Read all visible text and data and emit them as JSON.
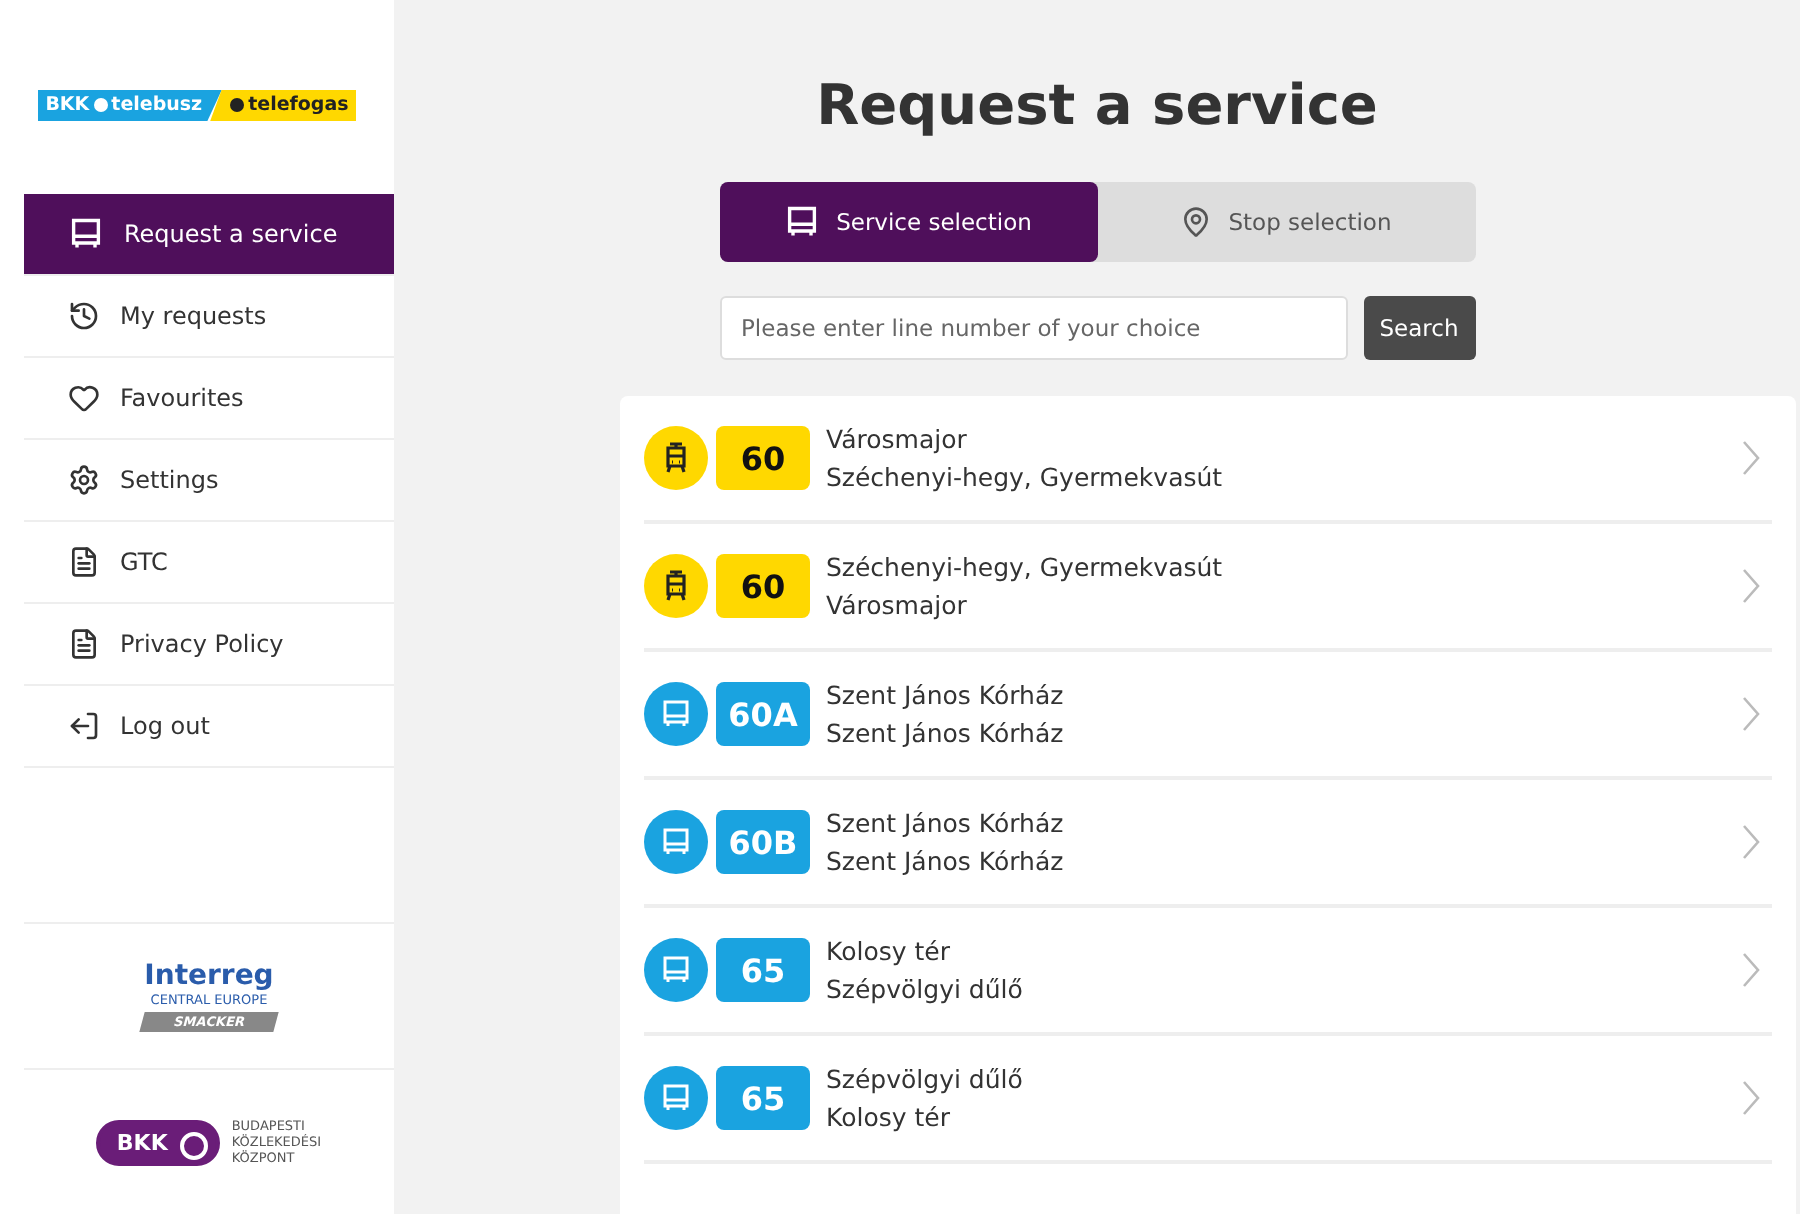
{
  "logo": {
    "brand": "BKK",
    "left": "telebusz",
    "right": "telefogas"
  },
  "menu": [
    {
      "label": "Request a service",
      "selected": true
    },
    {
      "label": "My requests",
      "selected": false
    },
    {
      "label": "Favourites",
      "selected": false
    },
    {
      "label": "Settings",
      "selected": false
    },
    {
      "label": "GTC",
      "selected": false
    },
    {
      "label": "Privacy Policy",
      "selected": false
    },
    {
      "label": "Log out",
      "selected": false
    }
  ],
  "partners": {
    "interreg": "Interreg",
    "region": "CENTRAL EUROPE",
    "project": "SMACKER",
    "bkk": "BKK",
    "bkk_name": [
      "BUDAPESTI",
      "KÖZLEKEDÉSI",
      "KÖZPONT"
    ]
  },
  "title": "Request a service",
  "tabs": [
    {
      "label": "Service selection",
      "selected": true
    },
    {
      "label": "Stop selection",
      "selected": false
    }
  ],
  "search": {
    "placeholder": "Please enter line number of your choice",
    "button": "Search"
  },
  "services": [
    {
      "kind": "tram",
      "line": "60",
      "from": "Városmajor",
      "to": "Széchenyi-hegy, Gyermekvasút"
    },
    {
      "kind": "tram",
      "line": "60",
      "from": "Széchenyi-hegy, Gyermekvasút",
      "to": "Városmajor"
    },
    {
      "kind": "bus",
      "line": "60A",
      "from": "Szent János Kórház",
      "to": "Szent János Kórház"
    },
    {
      "kind": "bus",
      "line": "60B",
      "from": "Szent János Kórház",
      "to": "Szent János Kórház"
    },
    {
      "kind": "bus",
      "line": "65",
      "from": "Kolosy tér",
      "to": "Szépvölgyi dűlő"
    },
    {
      "kind": "bus",
      "line": "65",
      "from": "Szépvölgyi dűlő",
      "to": "Kolosy tér"
    }
  ]
}
